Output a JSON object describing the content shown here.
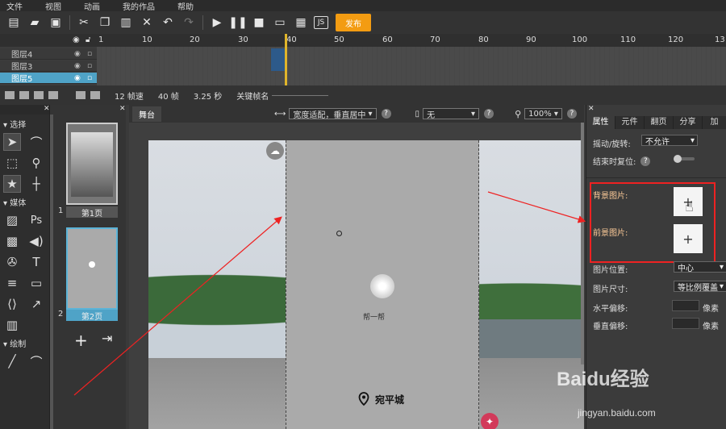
{
  "menu": [
    "文件",
    "视图",
    "动画",
    "我的作品",
    "帮助"
  ],
  "toolbar": {
    "publish_label": "发布",
    "js_label": "JS"
  },
  "timeline": {
    "ticks": [
      "1",
      "10",
      "20",
      "30",
      "40",
      "50",
      "60",
      "70",
      "80",
      "90",
      "100",
      "110",
      "120",
      "13"
    ],
    "layers": [
      "图层4",
      "图层3",
      "图层5"
    ],
    "selected_layer": "图层5"
  },
  "status": {
    "fps": "12 帧速",
    "frames": "40 帧",
    "duration": "3.25 秒",
    "keyframe_name": "关键帧名"
  },
  "tools": {
    "select_section": "选择",
    "media_section": "媒体",
    "draw_section": "绘制",
    "ps_label": "Ps",
    "text_label": "T"
  },
  "pages": {
    "page1_num": "1",
    "page1_label": "第1页",
    "page2_num": "2",
    "page2_label": "第2页",
    "add_symbol": "+"
  },
  "stage": {
    "tab": "舞台",
    "fit_mode": "宽度适配，垂直居中",
    "device": "无",
    "zoom": "100%",
    "tap_label": "帮一帮",
    "location_label": "宛平城"
  },
  "props": {
    "tabs": [
      "属性",
      "元件",
      "翻页",
      "分享",
      "加"
    ],
    "rotate_label": "摇动/旋转:",
    "rotate_value": "不允许",
    "reset_label": "结束时复位:",
    "bg_image_label": "背景图片:",
    "fg_image_label": "前景图片:",
    "image_pos_label": "图片位置:",
    "image_pos_value": "中心",
    "image_size_label": "图片尺寸:",
    "image_size_value": "等比例覆盖",
    "h_offset_label": "水平偏移:",
    "v_offset_label": "垂直偏移:",
    "unit": "像素",
    "plus": "+"
  },
  "watermark": {
    "brand": "Baidu经验",
    "url": "jingyan.baidu.com"
  }
}
